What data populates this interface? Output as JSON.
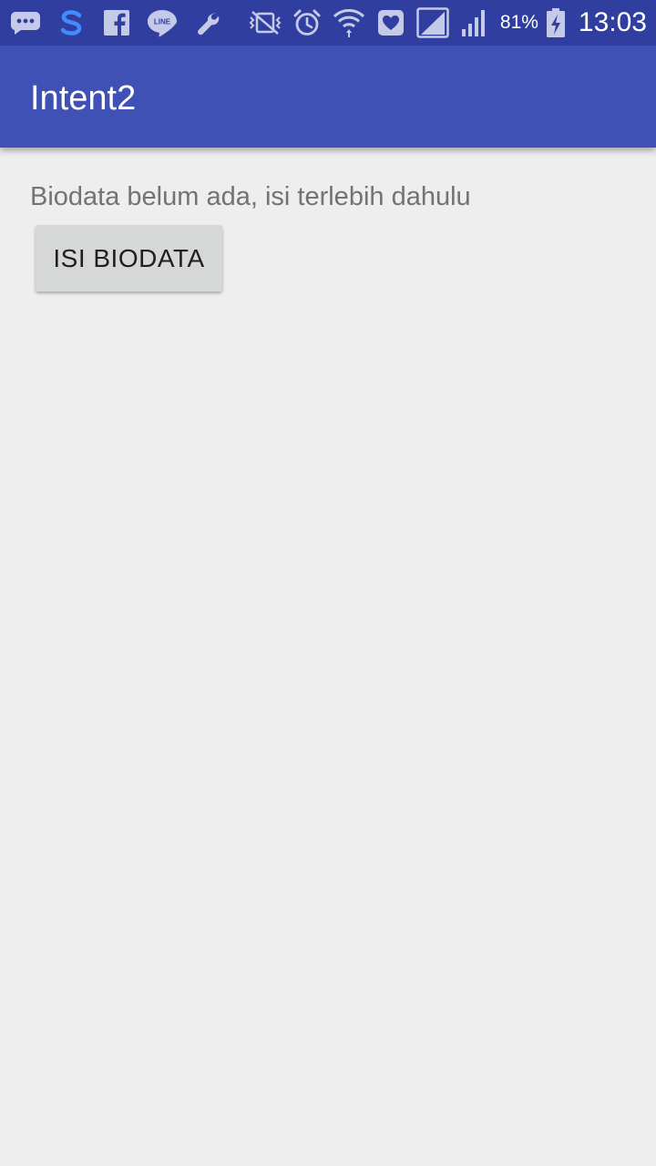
{
  "status_bar": {
    "left_icons": [
      "messages-icon",
      "s-app-icon",
      "facebook-icon",
      "line-icon",
      "wrench-icon"
    ],
    "right_icons": [
      "vibrate-icon",
      "alarm-icon",
      "wifi-icon",
      "heart-icon",
      "signal-icon",
      "signal-2-icon",
      "battery-charging-icon"
    ],
    "battery_percent": "81%",
    "time": "13:03"
  },
  "app_bar": {
    "title": "Intent2",
    "color": "#3f51b5"
  },
  "main": {
    "message": "Biodata belum ada, isi terlebih dahulu",
    "button_label": "ISI BIODATA"
  },
  "colors": {
    "status_bar": "#303f9f",
    "background": "#eeeeee",
    "button": "#d6d7d7"
  }
}
